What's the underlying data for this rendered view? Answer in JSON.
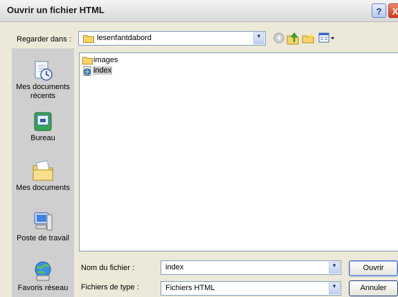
{
  "window": {
    "title": "Ouvrir un fichier HTML",
    "help": "?",
    "close": "X"
  },
  "lookin": {
    "label": "Regarder dans :",
    "value": "lesenfantdabord"
  },
  "places": [
    {
      "label": "Mes documents récents",
      "icon": "recent-documents-icon"
    },
    {
      "label": "Bureau",
      "icon": "desktop-icon"
    },
    {
      "label": "Mes documents",
      "icon": "my-documents-icon"
    },
    {
      "label": "Poste de travail",
      "icon": "my-computer-icon"
    },
    {
      "label": "Favoris réseau",
      "icon": "network-places-icon"
    }
  ],
  "files": [
    {
      "name": "images",
      "icon": "folder-icon",
      "selected": false
    },
    {
      "name": "index",
      "icon": "html-file-icon",
      "selected": true
    }
  ],
  "filename": {
    "label": "Nom du fichier :",
    "value": "index"
  },
  "filetype": {
    "label": "Fichiers de type :",
    "value": "Fichiers HTML"
  },
  "buttons": {
    "open": "Ouvrir",
    "cancel": "Annuler"
  },
  "colors": {
    "dialog_bg": "#ece9d8",
    "places_bg": "#cfcfcf",
    "selection": "#c9c9c9"
  }
}
